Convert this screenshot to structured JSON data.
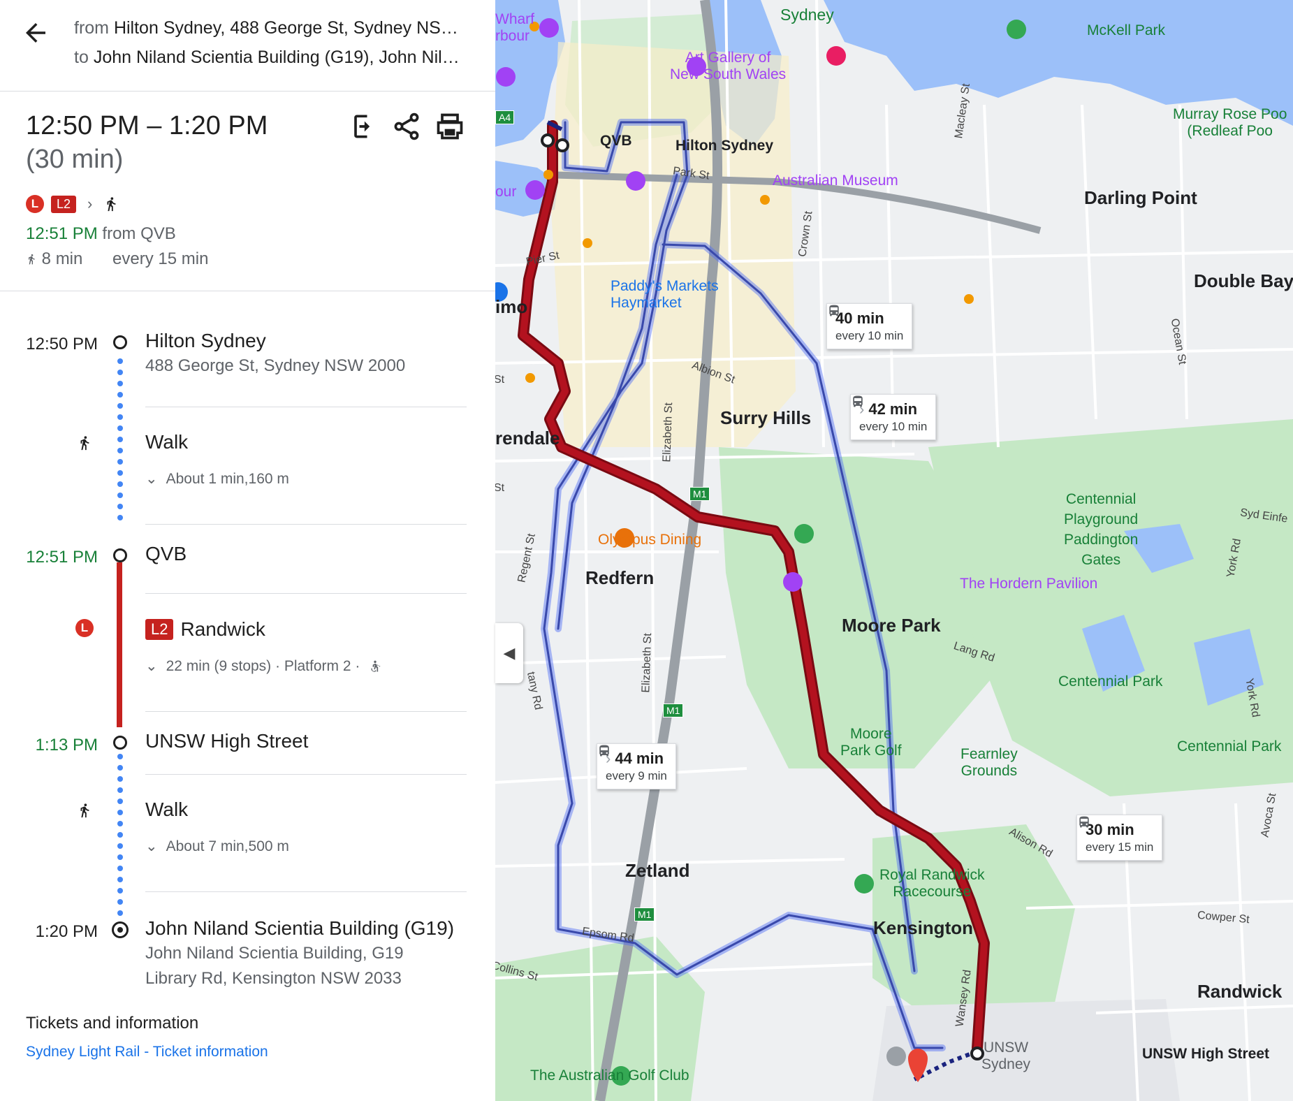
{
  "header": {
    "from_prefix": "from",
    "from_text": "Hilton Sydney, 488 George St, Sydney NSW…",
    "to_prefix": "to",
    "to_text": "John Niland Scientia Building (G19), John Nila…"
  },
  "summary": {
    "time_range": "12:50 PM – 1:20 PM",
    "duration": "(30 min)",
    "rail_letter": "L",
    "line_badge": "L2",
    "departure_time": "12:51 PM",
    "departure_from": "from QVB",
    "walk_total": "8 min",
    "frequency": "every 15 min"
  },
  "steps": {
    "start_time": "12:50 PM",
    "start_name": "Hilton Sydney",
    "start_address": "488 George St, Sydney NSW 2000",
    "walk1_label": "Walk",
    "walk1_detail": "About 1 min,160 m",
    "qvb_time": "12:51 PM",
    "qvb_name": "QVB",
    "rail_letter": "L",
    "line_badge": "L2",
    "line_dest": "Randwick",
    "line_detail": "22 min (9 stops) · Platform 2 ·",
    "unsw_time": "1:13 PM",
    "unsw_name": "UNSW High Street",
    "walk2_label": "Walk",
    "walk2_detail": "About 7 min,500 m",
    "end_time": "1:20 PM",
    "end_name": "John Niland Scientia Building (G19)",
    "end_address_1": "John Niland Scientia Building, G19",
    "end_address_2": "Library Rd, Kensington NSW 2033"
  },
  "tickets": {
    "title": "Tickets and information",
    "link1": "Sydney Light Rail",
    "separator": " - ",
    "link2": "Ticket information"
  },
  "map": {
    "callouts": [
      {
        "time": "40 min",
        "freq": "every 10 min"
      },
      {
        "time": "42 min",
        "freq": "every 10 min"
      },
      {
        "time": "44 min",
        "freq": "every 9 min"
      },
      {
        "time": "30 min",
        "freq": "every 15 min"
      }
    ],
    "area_labels": [
      "Sydney",
      "Darling Point",
      "Double Bay",
      "Surry Hills",
      "Redfern",
      "Moore Park",
      "Zetland",
      "Kensington",
      "Randwick",
      "imo",
      "rendale"
    ],
    "poi_labels": {
      "art_gallery": "Art Gallery of\nNew South Wales",
      "australian_museum": "Australian Museum",
      "paddys": "Paddy's Markets\nHaymarket",
      "olympus": "Olympus Dining",
      "hordern": "The Hordern Pavilion",
      "mckell": "McKell Park",
      "murray_rose": "Murray Rose Poo\n(Redleaf Poo",
      "centennial_gates": "Centennial\nPlayground\nPaddington\nGates",
      "centennial_park": "Centennial Park",
      "centennial_park2": "Centennial Park",
      "moore_park_golf": "Moore\nPark Golf",
      "fearnley": "Fearnley\nGrounds",
      "royal_randwick": "Royal Randwick\nRacecourse",
      "golf_club": "The Australian Golf Club",
      "unsw": "UNSW\nSydney",
      "wharf": "Wharf\nrbour",
      "our": "our"
    },
    "stop_labels": {
      "qvb": "QVB",
      "hilton": "Hilton Sydney",
      "unsw_high": "UNSW High Street"
    },
    "streets": [
      "Pier St",
      "Park St",
      "Crown St",
      "Macleay St",
      "Albion St",
      "Elizabeth St",
      "Elizabeth St",
      "Regent St",
      "Lang Rd",
      "Alison Rd",
      "Epsom Rd",
      "Collins St",
      "Wansey Rd",
      "Cowper St",
      "York Rd",
      "York Rd",
      "Ocean St",
      "Syd Einfe",
      "Avoca St",
      "tany Rd",
      "St",
      "St"
    ],
    "shields": [
      "A4",
      "M1",
      "M1",
      "M1"
    ],
    "colors": {
      "rail": "#b3121f",
      "bus": "#4f6df5",
      "water": "#9cc0f9",
      "park": "#c5e8c5"
    }
  }
}
